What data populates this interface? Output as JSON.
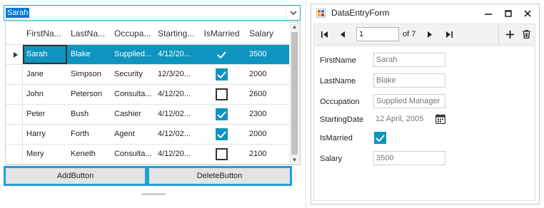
{
  "combo": {
    "selected_text": "Sarah"
  },
  "grid": {
    "columns": [
      "FirstNa...",
      "LastNa...",
      "Occupa...",
      "Starting...",
      "IsMarried",
      "Salary"
    ],
    "rows": [
      {
        "first": "Sarah",
        "last": "Blake",
        "occupation": "Supplied...",
        "start": "4/12/20...",
        "married": true,
        "salary": "3500"
      },
      {
        "first": "Jane",
        "last": "Simpson",
        "occupation": "Security",
        "start": "12/3/20...",
        "married": true,
        "salary": "2000"
      },
      {
        "first": "John",
        "last": "Peterson",
        "occupation": "Consulta...",
        "start": "4/12/20...",
        "married": false,
        "salary": "2600"
      },
      {
        "first": "Peter",
        "last": "Bush",
        "occupation": "Cashier",
        "start": "4/12/02...",
        "married": true,
        "salary": "2300"
      },
      {
        "first": "Harry",
        "last": "Forth",
        "occupation": "Agent",
        "start": "4/12/02...",
        "married": true,
        "salary": "2000"
      },
      {
        "first": "Mery",
        "last": "Keneth",
        "occupation": "Consulta...",
        "start": "4/12/20...",
        "married": false,
        "salary": "2100"
      }
    ],
    "selected_row": 0
  },
  "buttons": {
    "add": "AddButton",
    "delete": "DeleteButton"
  },
  "window": {
    "title": "DataEntryForm",
    "navigator": {
      "position": "1",
      "of_text": "of 7"
    },
    "form": {
      "first_label": "FirstName",
      "first_value": "Sarah",
      "last_label": "LastName",
      "last_value": "Blake",
      "occ_label": "Occupation",
      "occ_value": "Supplied Manager",
      "date_label": "StartingDate",
      "date_value": "12 April, 2005",
      "married_label": "IsMarried",
      "married_value": true,
      "salary_label": "Salary",
      "salary_value": "3500"
    }
  },
  "colors": {
    "accent": "#0f94bf",
    "focus_border": "#1ea0d8",
    "selection": "#0078d7"
  },
  "icons": [
    "chevron-down-icon",
    "row-indicator-icon",
    "check-icon",
    "app-icon",
    "minimize-icon",
    "maximize-icon",
    "close-icon",
    "first-icon",
    "previous-icon",
    "next-icon",
    "last-icon",
    "add-icon",
    "delete-icon",
    "calendar-icon"
  ]
}
